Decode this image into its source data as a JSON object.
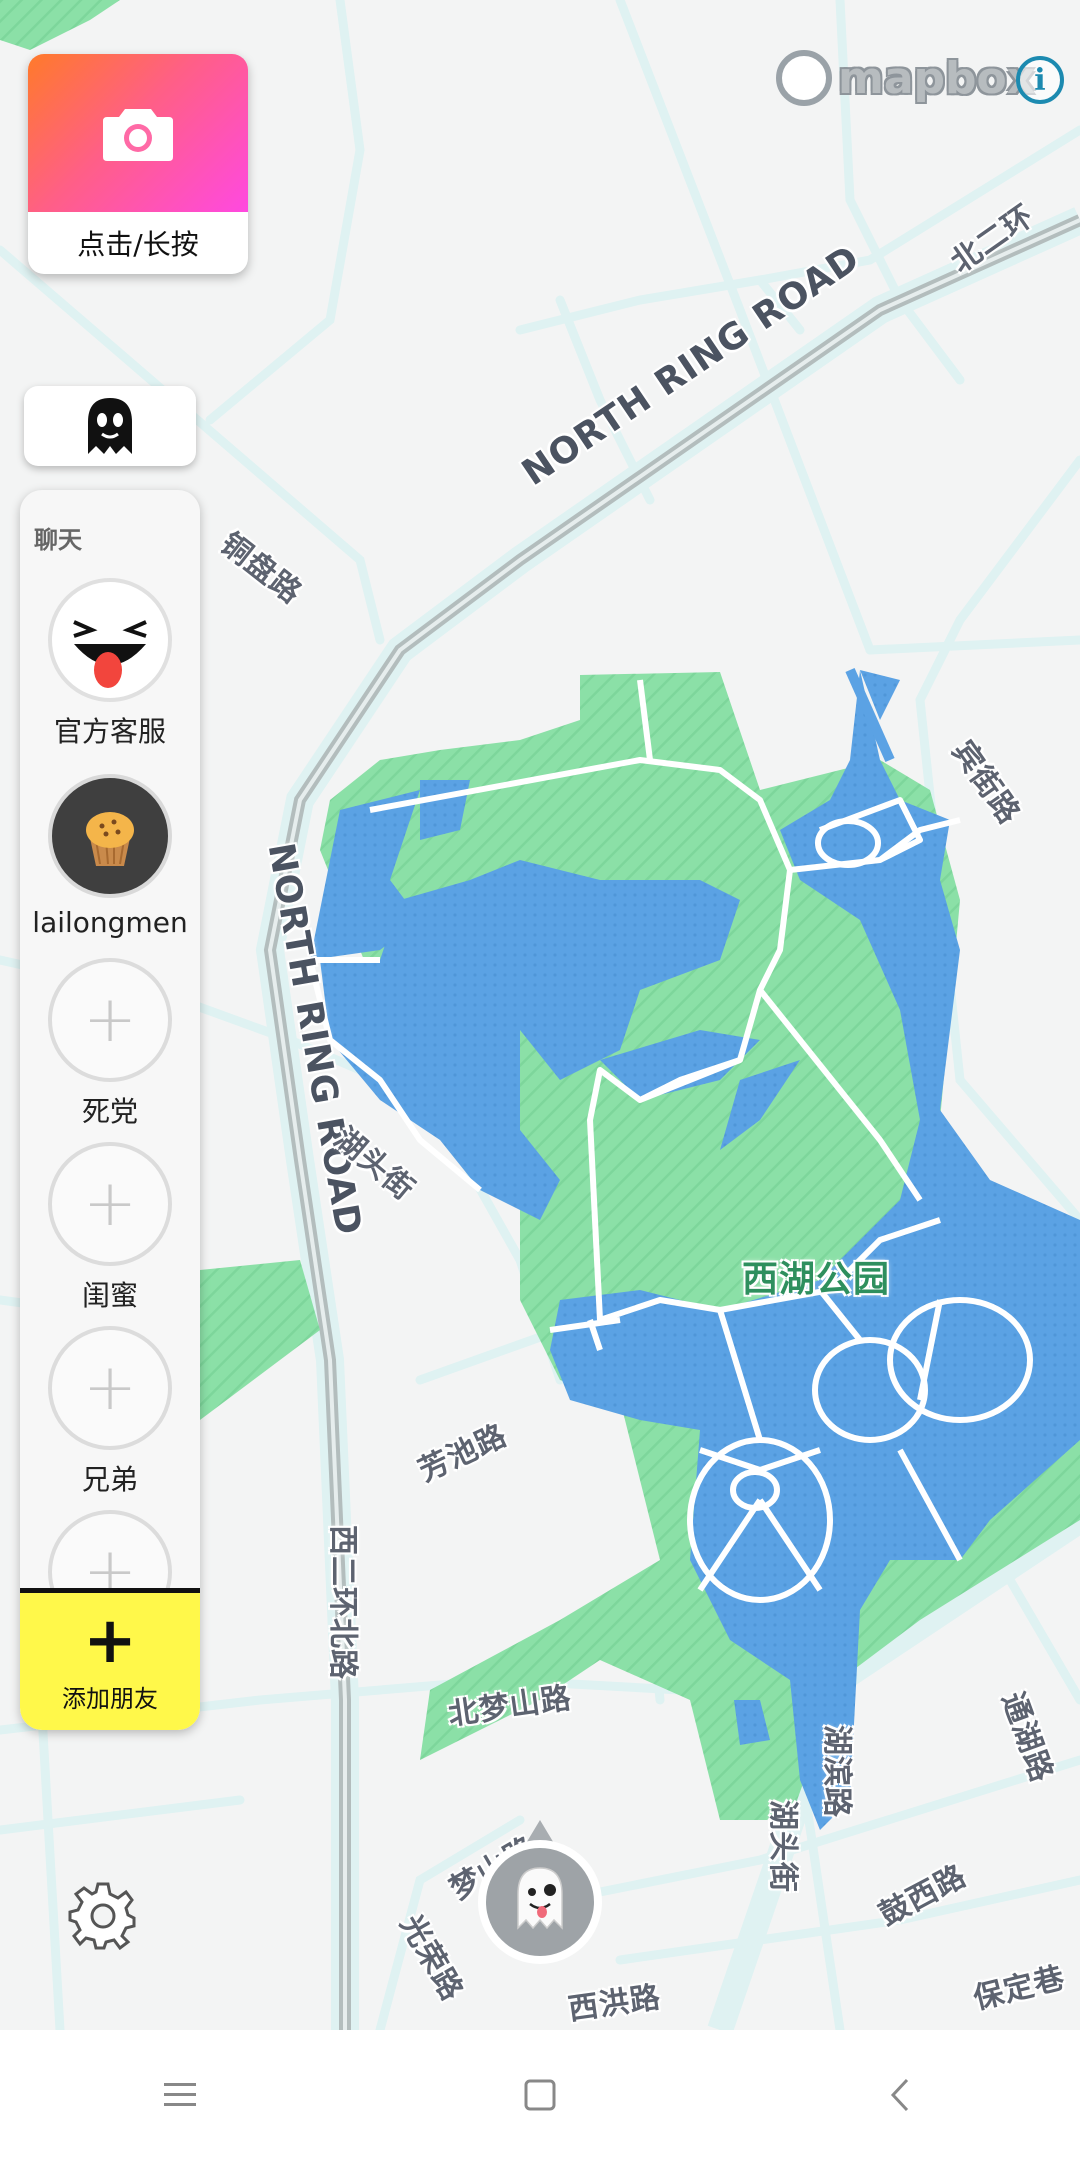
{
  "map": {
    "attribution_word": "mapbox",
    "info_glyph": "i",
    "labels": {
      "north_ring_road_upper": "NORTH RING ROAD",
      "north_ring_road_lower": "NORTH RING ROAD",
      "bei_er_huan": "北二环",
      "tong_pan_lu": "铜盘路",
      "xian_gu_lu": "宾街路",
      "hu_tou_jie_1": "湖头街",
      "xihu_park": "西湖公园",
      "fang_chi_lu": "芳池路",
      "xi_er_huan_bei_lu": "西二环北路",
      "bei_meng_shan_lu": "北梦山路",
      "meng_shan_lu": "梦山路",
      "guang_rong_lu": "光荣路",
      "xi_hong_lu": "西洪路",
      "hu_bin_lu": "湖滨路",
      "hu_tou_jie_2": "湖头街",
      "gu_xi_lu": "鼓西路",
      "tong_hu_lu": "通湖路",
      "bao_ding_xiang": "保定巷"
    },
    "colors": {
      "water": "#5ba2e4",
      "park": "#8be0a7",
      "road": "#dff2f2",
      "ring_road": "#b9c4c4"
    }
  },
  "camera": {
    "label": "点击/长按",
    "icon": "camera-icon"
  },
  "ghost_button": {
    "icon": "ghost-icon"
  },
  "chat": {
    "title": "聊天",
    "contacts": [
      {
        "name": "官方客服",
        "avatar": "laughing-face-avatar"
      },
      {
        "name": "lailongmen",
        "avatar": "muffin-avatar"
      },
      {
        "name": "死党",
        "avatar": "plus-icon",
        "glyph": "+"
      },
      {
        "name": "闺蜜",
        "avatar": "plus-icon",
        "glyph": "+"
      },
      {
        "name": "兄弟",
        "avatar": "plus-icon",
        "glyph": "+"
      },
      {
        "name": "",
        "avatar": "plus-icon",
        "glyph": "+"
      }
    ],
    "add_friend": {
      "glyph": "+",
      "label": "添加朋友"
    }
  },
  "settings": {
    "icon": "gear-icon"
  },
  "navbar": {
    "items": [
      "menu-icon",
      "home-square-icon",
      "back-chevron-icon"
    ]
  }
}
